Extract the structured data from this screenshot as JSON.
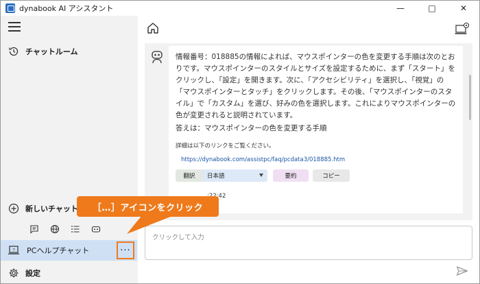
{
  "window": {
    "title": "dynabook AI アシスタント",
    "controls": {
      "minimize": "—",
      "maximize": "□",
      "close": "✕"
    }
  },
  "sidebar": {
    "history_label": "チャットルーム",
    "new_chat_label": "新しいチャットルーム",
    "active_chat_label": "PCヘルプチャット",
    "more_button_label": "···",
    "settings_label": "設定",
    "mini_icons": [
      "chat-icon",
      "globe-icon",
      "list-icon",
      "robot-icon"
    ]
  },
  "message": {
    "body": "情報番号：018885の情報によれば、マウスポインターの色を変更する手順は次のとおりです。マウスポインターのスタイルとサイズを設定するために、まず「スタート」をクリックし、「設定」を開きます。次に、「アクセシビリティ」を選択し、「視覚」の「マウスポインターとタッチ」をクリックします。その後、「マウスポインターのスタイル」で「カスタム」を選び、好みの色を選択します。これによりマウスポインターの色が変更されると説明されています。",
    "answer": "答えは：マウスポインターの色を変更する手順",
    "detail_note": "詳細は以下のリンクをご覧ください。",
    "link": "https://dynabook.com/assistpc/faq/pcdata3/018885.htm",
    "translate_label": "翻訳",
    "language_value": "日本語",
    "summary_label": "要約",
    "copy_label": "コピー",
    "timestamp": ":22:42"
  },
  "input": {
    "placeholder": "クリックして入力"
  },
  "callout": {
    "text": "［…］アイコンをクリック"
  },
  "colors": {
    "accent": "#ee7a1b",
    "active_row": "#cfe0f5",
    "sidebar_bg": "#f2f2f2",
    "link": "#1a55a6"
  }
}
